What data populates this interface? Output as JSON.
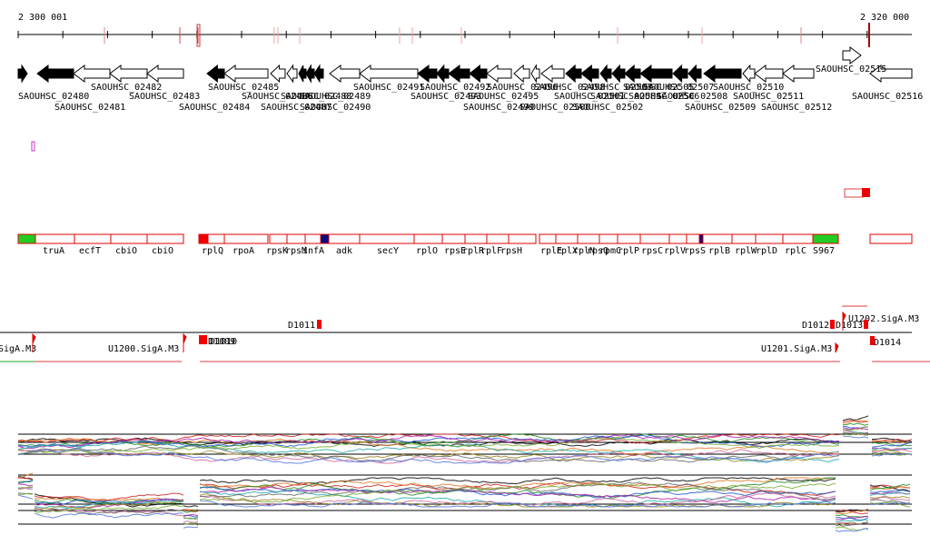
{
  "browser": {
    "coordinate_start": "2 300 001",
    "coordinate_end": "2 320 000"
  },
  "genes": {
    "forward_labels": [
      "SAOUHSC_02480",
      "SAOUHSC_02482",
      "SAOUHSC_02483",
      "SAOUHSC_02485",
      "SAOUHSC_02489",
      "SAOUHSC_02491",
      "SAOUHSC_02495",
      "SAOUHSC_02507",
      "SAOUHSC_02508",
      "SAOUHSC_02510",
      "SAOUHSC_02515",
      "SAOUHSC_02516"
    ],
    "reverse_labels": [
      "SAOUHSC_02481",
      "SAOUHSC_02484",
      "SAOUHSC_02487",
      "SAOUHSC_02490",
      "SAOUHSC_02499",
      "SAOUHSC_02506",
      "SAOUHSC_02509",
      "SAOUHSC_02511",
      "SAOUHSC_02512"
    ],
    "partial_labels": [
      "SAOUHSC_02486",
      "SAOUHSC_02488",
      "SAOUHSC_02492",
      "SAOUHSC_02493",
      "SAOUHSC_02496",
      "SAOUHSC_02498",
      "SAOUHSC_02500",
      "SAOUHSC_02501",
      "SAOUHSC_02502",
      "SAOUHSC_02503",
      "SAOUHSC_02504",
      "SAOUHSC_02505"
    ]
  },
  "operons": {
    "labels": [
      "truA",
      "ecfT",
      "cbiO",
      "cbiO",
      "rplQ",
      "rpoA",
      "rpsK",
      "rpsM",
      "infA",
      "adk",
      "secY",
      "rplO",
      "rpsE",
      "rplR",
      "rplF",
      "rpsH",
      "rplE",
      "rplX",
      "rplN",
      "rpsQ",
      "rpmC",
      "rplP",
      "rpsC",
      "rplV",
      "rpsS",
      "rplB",
      "rplW",
      "rplD",
      "rplC",
      "S967"
    ]
  },
  "features": {
    "promoters": [
      "U1200.SigA.M3",
      "U1201.SigA.M3",
      "U1202.SigA.M3",
      "SigA.M3"
    ],
    "terminators": [
      "D1011",
      "D1012",
      "D1013",
      "D1014",
      "D1009",
      "D1010"
    ]
  },
  "colors": {
    "operon_outline": "#e00000",
    "highlight_green": "#22cc22",
    "highlight_navy": "#0a0a80",
    "highlight_red": "#ee0000",
    "bar_outline": "#e04040",
    "magenta_mark": "#cc33cc",
    "tick_red": "#e08080"
  },
  "icons": {
    "forward_gene": "right-arrow-icon",
    "reverse_gene": "left-arrow-icon",
    "promoter": "red-flag-icon",
    "terminator": "red-square-icon"
  }
}
